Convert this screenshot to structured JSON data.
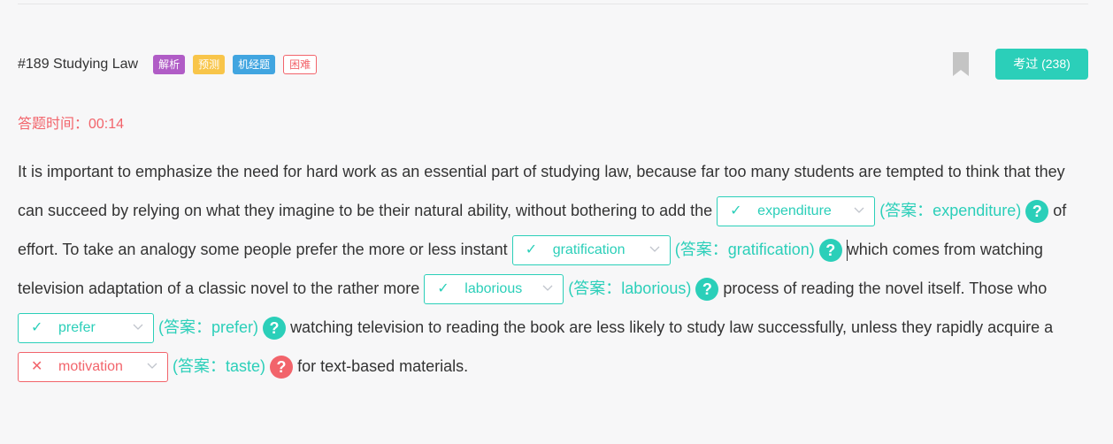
{
  "question": {
    "title": "#189 Studying Law",
    "badges": [
      "解析",
      "预测",
      "机经题",
      "困难"
    ],
    "exam_button": "考过 (238)",
    "timer": "答题时间：00:14"
  },
  "passage": {
    "t1": "It is important to emphasize the need for hard work as an essential part of studying law, because far too many students are tempted to think that they can succeed by relying on what they imagine to be their natural ability, without bothering to add the",
    "t2": " of effort. To take an analogy some people prefer the more or less instant",
    "t3": "which comes from watching television adaptation of a classic novel to the rather more",
    "t4": " process of reading the novel itself. Those who",
    "t5": " watching television to reading the book are less likely to study law successfully, unless they rapidly acquire a",
    "t6": " for text-based materials."
  },
  "blanks": [
    {
      "selected": "expenditure",
      "answer": "(答案：expenditure)",
      "status": "correct"
    },
    {
      "selected": "gratification",
      "answer": "(答案：gratification)",
      "status": "correct"
    },
    {
      "selected": "laborious",
      "answer": "(答案：laborious)",
      "status": "correct"
    },
    {
      "selected": "prefer",
      "answer": "(答案：prefer)",
      "status": "correct"
    },
    {
      "selected": "motivation",
      "answer": "(答案：taste)",
      "status": "wrong"
    }
  ],
  "icons": {
    "correct": "✓",
    "wrong": "✕",
    "help": "?"
  },
  "colors": {
    "accent": "#2bcfb9",
    "error": "#f2646b",
    "badge_purple": "#b05cc6",
    "badge_yellow": "#f8c54a",
    "badge_blue": "#41a5e0"
  }
}
